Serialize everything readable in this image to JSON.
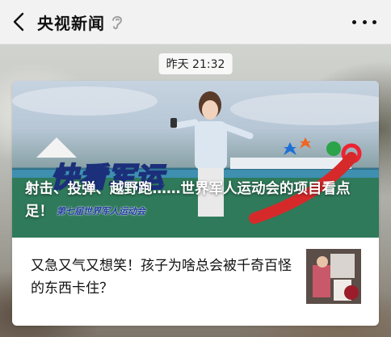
{
  "header": {
    "title": "央视新闻",
    "back_icon": "chevron-left-icon",
    "ear_icon": "ear-icon",
    "more_icon": "more-dots-icon"
  },
  "timestamp": "昨天 21:32",
  "card": {
    "cover": {
      "logo_text": "快看军运",
      "title": "射击、投弹、越野跑……世界军人运动会的项目看点足！",
      "subtitle": "第七届世界军人运动会"
    },
    "items": [
      {
        "title": "又急又气又想笑！孩子为啥总会被千奇百怪的东西卡住？"
      }
    ]
  }
}
